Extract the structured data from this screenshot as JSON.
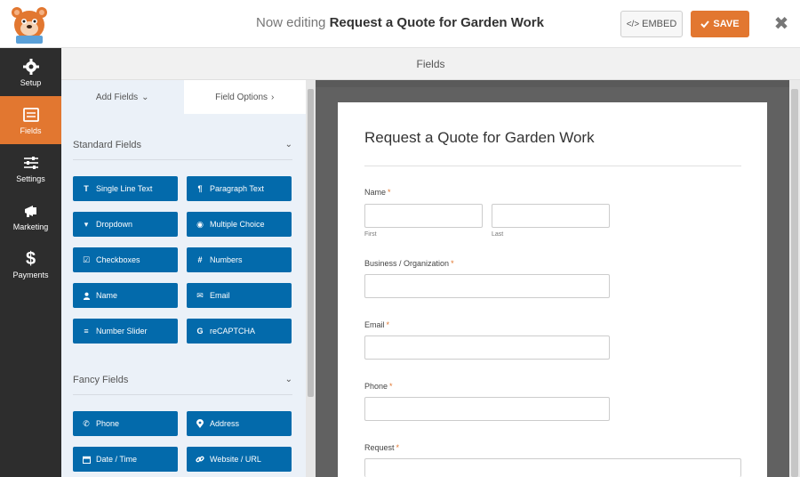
{
  "header": {
    "editing_prefix": "Now editing",
    "form_name": "Request a Quote for Garden Work",
    "embed_label": "EMBED",
    "save_label": "SAVE",
    "close_glyph": "✖"
  },
  "nav": {
    "items": [
      {
        "label": "Setup",
        "icon": "gear-icon",
        "active": false
      },
      {
        "label": "Fields",
        "icon": "fields-icon",
        "active": true
      },
      {
        "label": "Settings",
        "icon": "sliders-icon",
        "active": false
      },
      {
        "label": "Marketing",
        "icon": "megaphone-icon",
        "active": false
      },
      {
        "label": "Payments",
        "icon": "dollar-icon",
        "active": false
      }
    ]
  },
  "panel_title": "Fields",
  "sidebar": {
    "tabs": [
      {
        "label": "Add Fields",
        "chevron": "⌄"
      },
      {
        "label": "Field Options",
        "chevron": "›"
      }
    ],
    "sections": [
      {
        "title": "Standard Fields",
        "fields": [
          {
            "label": "Single Line Text",
            "icon": "text-icon",
            "glyph": "T"
          },
          {
            "label": "Paragraph Text",
            "icon": "paragraph-icon",
            "glyph": "¶"
          },
          {
            "label": "Dropdown",
            "icon": "dropdown-icon",
            "glyph": "▾"
          },
          {
            "label": "Multiple Choice",
            "icon": "radio-icon",
            "glyph": "◉"
          },
          {
            "label": "Checkboxes",
            "icon": "checkbox-icon",
            "glyph": "☑"
          },
          {
            "label": "Numbers",
            "icon": "hash-icon",
            "glyph": "#"
          },
          {
            "label": "Name",
            "icon": "user-icon",
            "glyph": "👤"
          },
          {
            "label": "Email",
            "icon": "envelope-icon",
            "glyph": "✉"
          },
          {
            "label": "Number Slider",
            "icon": "slider-icon",
            "glyph": "≡"
          },
          {
            "label": "reCAPTCHA",
            "icon": "google-icon",
            "glyph": "G"
          }
        ]
      },
      {
        "title": "Fancy Fields",
        "fields": [
          {
            "label": "Phone",
            "icon": "phone-icon",
            "glyph": "✆"
          },
          {
            "label": "Address",
            "icon": "map-pin-icon",
            "glyph": "⚲"
          },
          {
            "label": "Date / Time",
            "icon": "calendar-icon",
            "glyph": "▦"
          },
          {
            "label": "Website / URL",
            "icon": "link-icon",
            "glyph": "🔗"
          }
        ]
      }
    ]
  },
  "form": {
    "title": "Request a Quote for Garden Work",
    "fields": {
      "name": {
        "label": "Name",
        "first": "First",
        "last": "Last"
      },
      "business": {
        "label": "Business / Organization"
      },
      "email": {
        "label": "Email"
      },
      "phone": {
        "label": "Phone"
      },
      "request": {
        "label": "Request"
      }
    },
    "required_mark": "*"
  },
  "colors": {
    "accent": "#e27730",
    "field_button": "#036aab",
    "nav_bg": "#2d2d2d"
  }
}
